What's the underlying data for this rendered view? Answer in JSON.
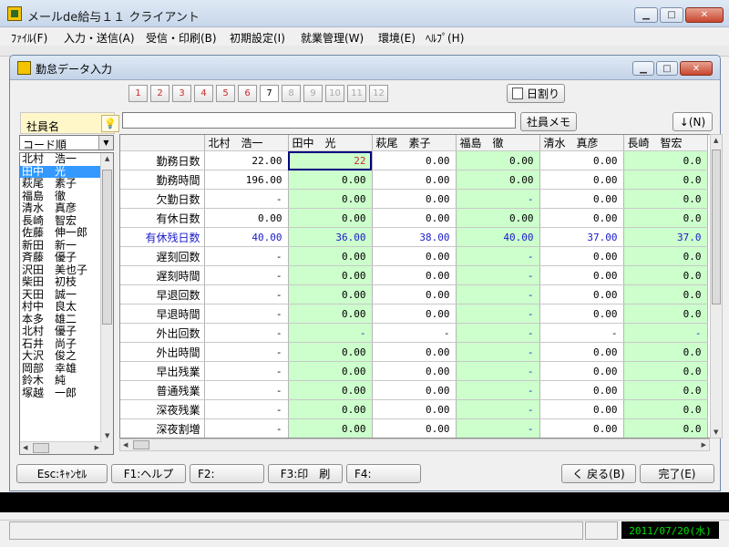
{
  "app": {
    "title": "メールde給与１１ クライアント",
    "win": {
      "min": "▁",
      "max": "□",
      "close": "✕"
    }
  },
  "menu": [
    "ﾌｧｲﾙ(F)",
    "入力・送信(A)",
    "受信・印刷(B)",
    "初期設定(I)",
    "就業管理(W)",
    "環境(E)",
    "ﾍﾙﾌﾟ(H)"
  ],
  "child": {
    "title": "勤怠データ入力"
  },
  "pager": [
    "1",
    "2",
    "3",
    "4",
    "5",
    "6",
    "7",
    "8",
    "9",
    "10",
    "11",
    "12"
  ],
  "pager_active": "7",
  "toolbar": {
    "daily_button": "日割り",
    "memo_button": "社員メモ",
    "next_button": "↓(N)",
    "search_value": ""
  },
  "employee_panel": {
    "label": "社員名",
    "sort": "コード順",
    "employees": [
      "北村　浩一",
      "田中　光",
      "萩尾　素子",
      "福島　徹",
      "清水　真彦",
      "長崎　智宏",
      "佐藤　伸一郎",
      "新田　新一",
      "斉藤　優子",
      "沢田　美也子",
      "柴田　初枝",
      "天田　誠一",
      "村中　良太",
      "本多　雄二",
      "北村　優子",
      "石井　尚子",
      "大沢　俊之",
      "岡部　幸雄",
      "鈴木　純",
      "塚越　一郎"
    ],
    "selected": "田中　光"
  },
  "grid": {
    "columns": [
      "北村　浩一",
      "田中　光",
      "萩尾　素子",
      "福島　徹",
      "清水　真彦",
      "長崎　智宏"
    ],
    "rows": [
      {
        "label": "勤務日数",
        "vals": [
          "22.00",
          "22",
          "0.00",
          "0.00",
          "0.00",
          "0.0"
        ]
      },
      {
        "label": "勤務時間",
        "vals": [
          "196.00",
          "0.00",
          "0.00",
          "0.00",
          "0.00",
          "0.0"
        ]
      },
      {
        "label": "欠勤日数",
        "vals": [
          "-",
          "0.00",
          "0.00",
          "-",
          "0.00",
          "0.0"
        ]
      },
      {
        "label": "有休日数",
        "vals": [
          "0.00",
          "0.00",
          "0.00",
          "0.00",
          "0.00",
          "0.0"
        ]
      },
      {
        "label": "有休残日数",
        "vals": [
          "40.00",
          "36.00",
          "38.00",
          "40.00",
          "37.00",
          "37.0"
        ]
      },
      {
        "label": "遅刻回数",
        "vals": [
          "-",
          "0.00",
          "0.00",
          "-",
          "0.00",
          "0.0"
        ]
      },
      {
        "label": "遅刻時間",
        "vals": [
          "-",
          "0.00",
          "0.00",
          "-",
          "0.00",
          "0.0"
        ]
      },
      {
        "label": "早退回数",
        "vals": [
          "-",
          "0.00",
          "0.00",
          "-",
          "0.00",
          "0.0"
        ]
      },
      {
        "label": "早退時間",
        "vals": [
          "-",
          "0.00",
          "0.00",
          "-",
          "0.00",
          "0.0"
        ]
      },
      {
        "label": "外出回数",
        "vals": [
          "-",
          "-",
          "-",
          "-",
          "-",
          "-"
        ]
      },
      {
        "label": "外出時間",
        "vals": [
          "-",
          "0.00",
          "0.00",
          "-",
          "0.00",
          "0.0"
        ]
      },
      {
        "label": "早出残業",
        "vals": [
          "-",
          "0.00",
          "0.00",
          "-",
          "0.00",
          "0.0"
        ]
      },
      {
        "label": "普通残業",
        "vals": [
          "-",
          "0.00",
          "0.00",
          "-",
          "0.00",
          "0.0"
        ]
      },
      {
        "label": "深夜残業",
        "vals": [
          "-",
          "0.00",
          "0.00",
          "-",
          "0.00",
          "0.0"
        ]
      },
      {
        "label": "深夜割増",
        "vals": [
          "-",
          "0.00",
          "0.00",
          "-",
          "0.00",
          "0.0"
        ]
      }
    ]
  },
  "footer": {
    "esc": "Esc:ｷｬﾝｾﾙ",
    "f1": "F1:ヘルプ",
    "f2": "F2:",
    "f3": "F3:印　刷",
    "f4": "F4:",
    "back": "く 戻る(B)",
    "done": "完了(E)"
  },
  "status": {
    "date": "2011/07/20(水)"
  }
}
